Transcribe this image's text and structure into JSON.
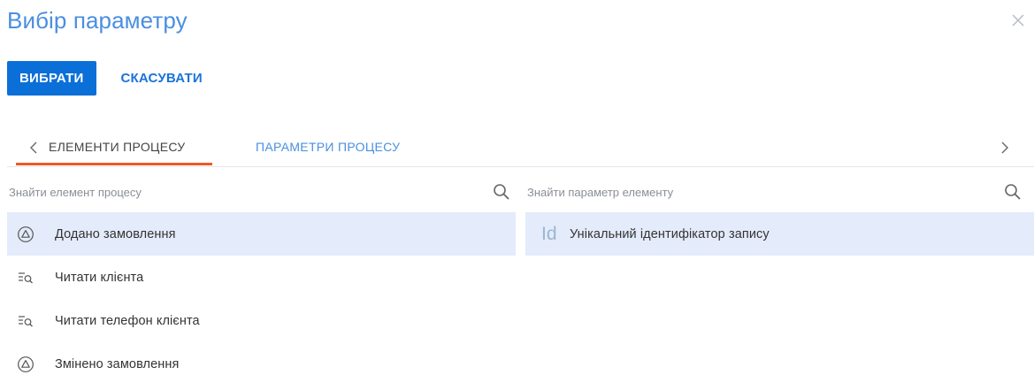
{
  "dialog": {
    "title": "Вибір параметру",
    "close_icon": "close-icon"
  },
  "toolbar": {
    "select_label": "ВИБРАТИ",
    "cancel_label": "СКАСУВАТИ"
  },
  "tabs": [
    {
      "label": "ЕЛЕМЕНТИ ПРОЦЕСУ",
      "active": true
    },
    {
      "label": "ПАРАМЕТРИ ПРОЦЕСУ",
      "active": false
    }
  ],
  "left_panel": {
    "search_placeholder": "Знайти елемент процесу",
    "items": [
      {
        "label": "Додано замовлення",
        "icon": "signal-start-icon",
        "selected": true
      },
      {
        "label": "Читати клієнта",
        "icon": "read-data-icon",
        "selected": false
      },
      {
        "label": "Читати телефон клієнта",
        "icon": "read-data-icon",
        "selected": false
      },
      {
        "label": "Змінено замовлення",
        "icon": "signal-start-icon",
        "selected": false
      }
    ]
  },
  "right_panel": {
    "search_placeholder": "Знайти параметр елементу",
    "items": [
      {
        "icon_text": "Id",
        "label": "Унікальний ідентифікатор запису",
        "selected": true
      }
    ]
  },
  "colors": {
    "accent_blue": "#0b6fd8",
    "link_blue": "#1a73d9",
    "title_blue": "#4a8fe0",
    "tab_underline": "#ee5a24",
    "selected_row": "#e4ebfa"
  }
}
